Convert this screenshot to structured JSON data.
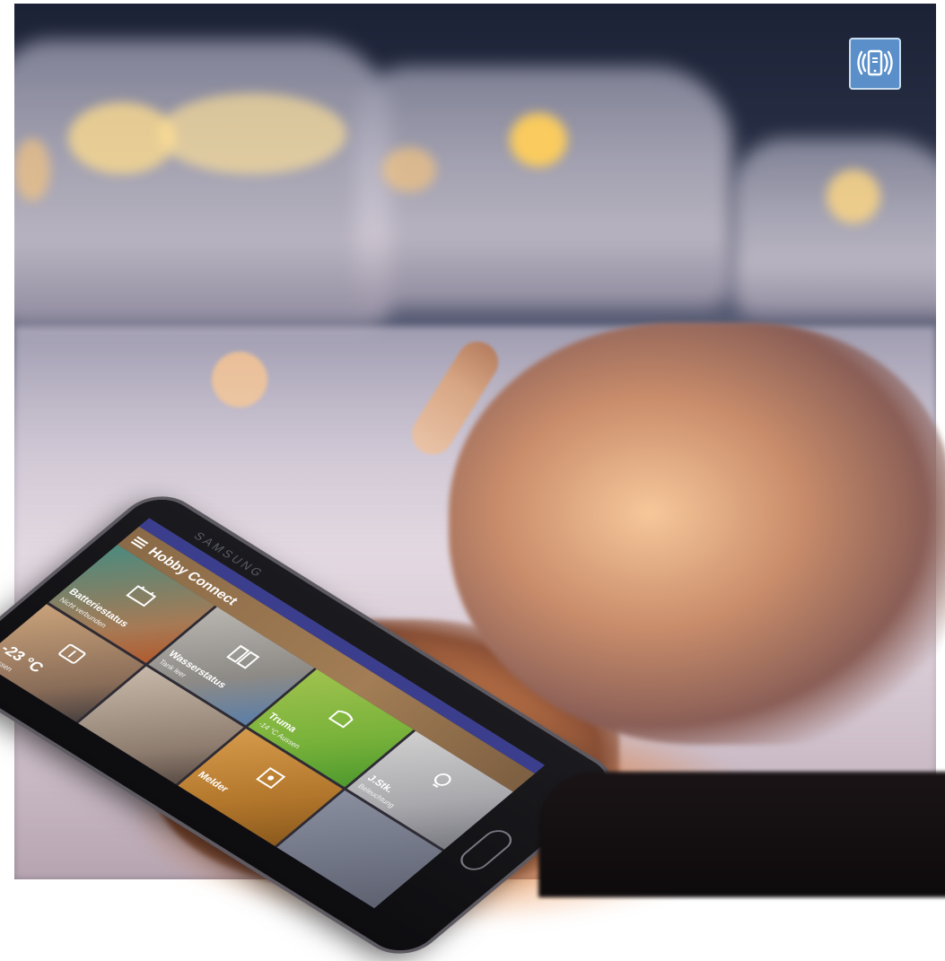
{
  "badge": {
    "icon": "phone-connectivity-icon",
    "color": "#5a8fc9"
  },
  "phone": {
    "brand": "SAMSUNG",
    "app_title": "Hobby Connect",
    "icons": {
      "menu": "hamburger-menu-icon"
    },
    "tiles": [
      {
        "label": "Batteriestatus",
        "sub": "Nicht verbunden"
      },
      {
        "label": "Wasserstatus",
        "sub": "Tank leer"
      },
      {
        "label": "Truma",
        "sub": "-14 °C Aussen"
      },
      {
        "label": "J.Stk.",
        "sub": "Beleuchtung"
      },
      {
        "big": "-23 °C",
        "sub": "Aussen"
      },
      {
        "label": "",
        "sub": ""
      },
      {
        "label": "Melder",
        "sub": ""
      },
      {
        "label": "",
        "sub": ""
      }
    ]
  },
  "colors": {
    "statusbar": "#3b3e8c",
    "appbar": "#a27d55",
    "truma_tile": "#78b23a"
  }
}
